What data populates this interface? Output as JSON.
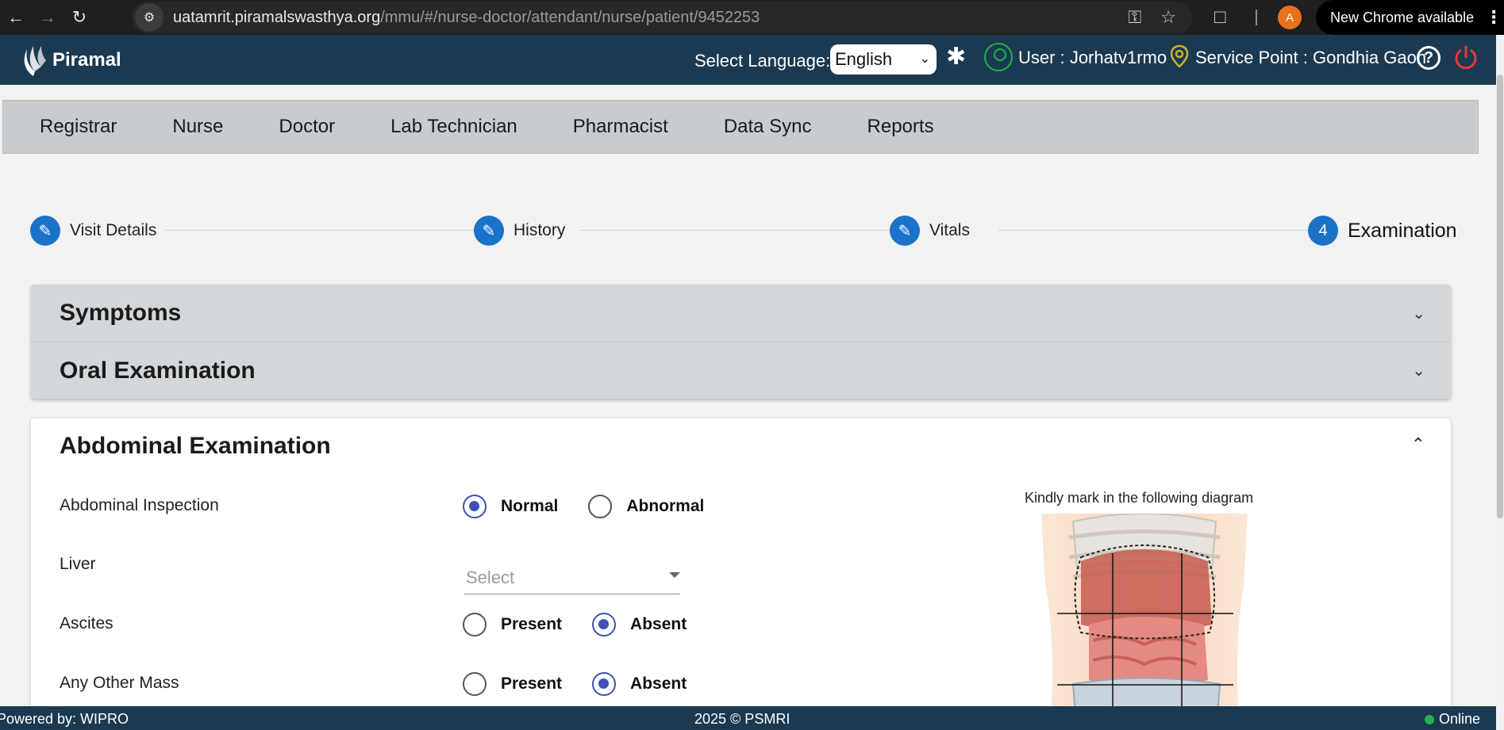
{
  "browser": {
    "url_host": "uatamrit.piramalswasthya.org",
    "url_path": "/mmu/#/nurse-doctor/attendant/nurse/patient/9452253",
    "profile_initial": "A",
    "update_label": "New Chrome available"
  },
  "header": {
    "brand": "Piramal",
    "language_label": "Select Language:",
    "language_value": "English",
    "user_label": "User :",
    "user_value": "Jorhatv1rmo",
    "service_label": "Service Point :",
    "service_value": "Gondhia Gaon",
    "help_glyph": "?"
  },
  "menu": [
    "Registrar",
    "Nurse",
    "Doctor",
    "Lab Technician",
    "Pharmacist",
    "Data Sync",
    "Reports"
  ],
  "stepper": {
    "steps": [
      {
        "label": "Visit Details",
        "state": "done"
      },
      {
        "label": "History",
        "state": "done"
      },
      {
        "label": "Vitals",
        "state": "done"
      },
      {
        "label": "Examination",
        "state": "active",
        "number": "4"
      }
    ]
  },
  "accordions": {
    "symptoms": "Symptoms",
    "oral": "Oral Examination"
  },
  "abdominal": {
    "title": "Abdominal Examination",
    "inspection": {
      "label": "Abdominal Inspection",
      "opt1": "Normal",
      "opt2": "Abnormal",
      "selected": "Normal"
    },
    "liver": {
      "label": "Liver",
      "placeholder": "Select"
    },
    "ascites": {
      "label": "Ascites",
      "opt1": "Present",
      "opt2": "Absent",
      "selected": "Absent"
    },
    "mass": {
      "label": "Any Other Mass",
      "opt1": "Present",
      "opt2": "Absent",
      "selected": "Absent"
    },
    "diagram_caption": "Kindly mark in the following diagram"
  },
  "footer": {
    "powered": "Powered by: WIPRO",
    "copyright": "2025 © PSMRI",
    "status": "Online"
  },
  "colors": {
    "header_bg": "#1b3a52",
    "step_blue": "#1a73c8",
    "radio_checked": "#3f51b5",
    "online_green": "#1fb34a",
    "power_red": "#e53935"
  }
}
